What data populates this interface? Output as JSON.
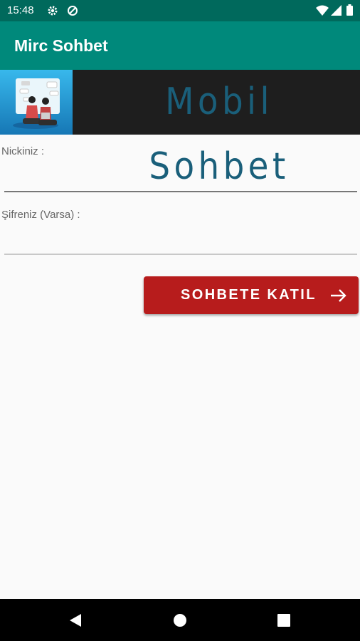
{
  "status_bar": {
    "time": "15:48",
    "icons": [
      "gear-icon",
      "data-saver-icon",
      "wifi-icon",
      "signal-icon",
      "battery-icon"
    ]
  },
  "app_bar": {
    "title": "Mirc Sohbet"
  },
  "banner": {
    "text": "Mobil Sohbet"
  },
  "form": {
    "nick_label": "Nickiniz :",
    "nick_value": "",
    "password_label": "Şifreniz (Varsa) :",
    "password_value": ""
  },
  "join_button": {
    "label": "SOHBETE KATIL",
    "icon": "arrow-right-icon"
  },
  "nav_bar": {
    "buttons": [
      "back-icon",
      "home-icon",
      "recents-icon"
    ]
  },
  "colors": {
    "status_bar": "#00695c",
    "app_bar": "#00897b",
    "button": "#b71c1c",
    "background": "#fafafa"
  }
}
